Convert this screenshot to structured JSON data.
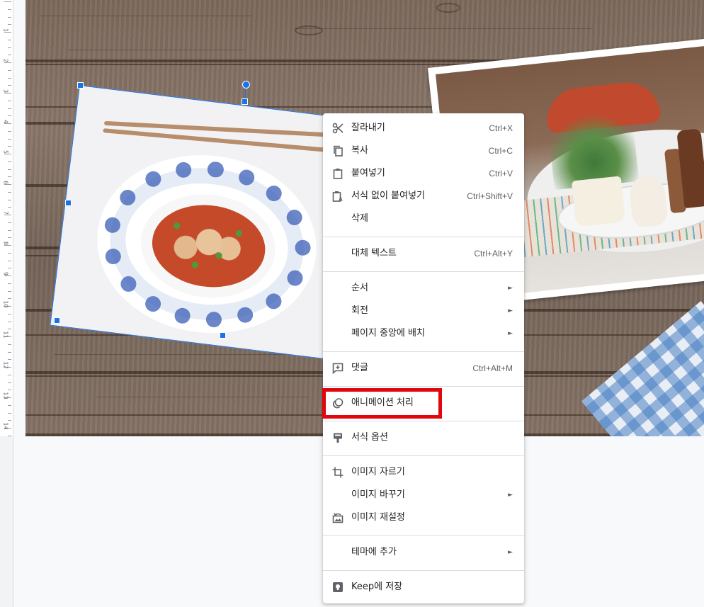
{
  "ruler": {
    "numbers": [
      "1",
      "2",
      "3",
      "4",
      "5",
      "6",
      "7",
      "8",
      "9",
      "10",
      "11",
      "12",
      "13",
      "14"
    ]
  },
  "slide": {
    "selected_image": "mapo-tofu-photo",
    "other_image": "table-plant-photo"
  },
  "context_menu": {
    "items": [
      {
        "label": "잘라내기",
        "shortcut": "Ctrl+X",
        "icon": "scissors-icon"
      },
      {
        "label": "복사",
        "shortcut": "Ctrl+C",
        "icon": "copy-icon"
      },
      {
        "label": "붙여넣기",
        "shortcut": "Ctrl+V",
        "icon": "clipboard-icon"
      },
      {
        "label": "서식 없이 붙여넣기",
        "shortcut": "Ctrl+Shift+V",
        "icon": "paste-plain-icon"
      },
      {
        "label": "삭제",
        "shortcut": "",
        "icon": ""
      },
      {
        "label": "대체 텍스트",
        "shortcut": "Ctrl+Alt+Y",
        "icon": ""
      },
      {
        "label": "순서",
        "shortcut": "",
        "icon": "",
        "submenu": true
      },
      {
        "label": "회전",
        "shortcut": "",
        "icon": "",
        "submenu": true
      },
      {
        "label": "페이지 중앙에 배치",
        "shortcut": "",
        "icon": "",
        "submenu": true
      },
      {
        "label": "댓글",
        "shortcut": "Ctrl+Alt+M",
        "icon": "add-comment-icon"
      },
      {
        "label": "애니메이션 처리",
        "shortcut": "",
        "icon": "animation-icon"
      },
      {
        "label": "서식 옵션",
        "shortcut": "",
        "icon": "format-options-icon"
      },
      {
        "label": "이미지 자르기",
        "shortcut": "",
        "icon": "crop-icon"
      },
      {
        "label": "이미지 바꾸기",
        "shortcut": "",
        "icon": "",
        "submenu": true
      },
      {
        "label": "이미지 재설정",
        "shortcut": "",
        "icon": "reset-image-icon"
      },
      {
        "label": "테마에 추가",
        "shortcut": "",
        "icon": "",
        "submenu": true
      },
      {
        "label": "Keep에 저장",
        "shortcut": "",
        "icon": "keep-icon"
      }
    ],
    "submenu_arrow": "►",
    "highlighted_item": "애니메이션 처리",
    "highlight_color": "#e0070d"
  }
}
